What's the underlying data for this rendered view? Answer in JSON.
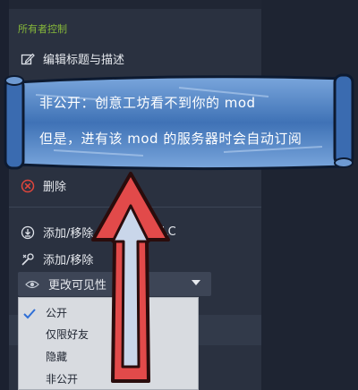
{
  "panel": {
    "section_title": "所有者控制",
    "edit_title_label": "编辑标题与描述",
    "delete_label": "删除",
    "add_remove_dlc_label": "添加/移除",
    "add_remove_dlc_suffix": "LC",
    "add_remove_label": "添加/移除",
    "visibility_label": "更改可见性"
  },
  "dropdown": {
    "options": [
      "公开",
      "仅限好友",
      "隐藏",
      "非公开"
    ],
    "selected": "公开"
  },
  "banner": {
    "line1": "非公开：创意工坊看不到你的 mod",
    "line2": "但是，进有该 mod 的服务器时会自动订阅"
  },
  "colors": {
    "section_green": "#86b83a",
    "check_blue": "#2f6fd6",
    "banner_blue": "#3f72b6",
    "arrow_red": "#e24a4a",
    "arrow_fill": "#c9d6ea"
  },
  "icons": {
    "edit": "edit-icon",
    "delete": "delete-icon",
    "dlc": "dlc-icon",
    "tools": "tools-icon",
    "eye": "eye-icon",
    "check": "check-icon",
    "caret": "chevron-down-icon"
  }
}
